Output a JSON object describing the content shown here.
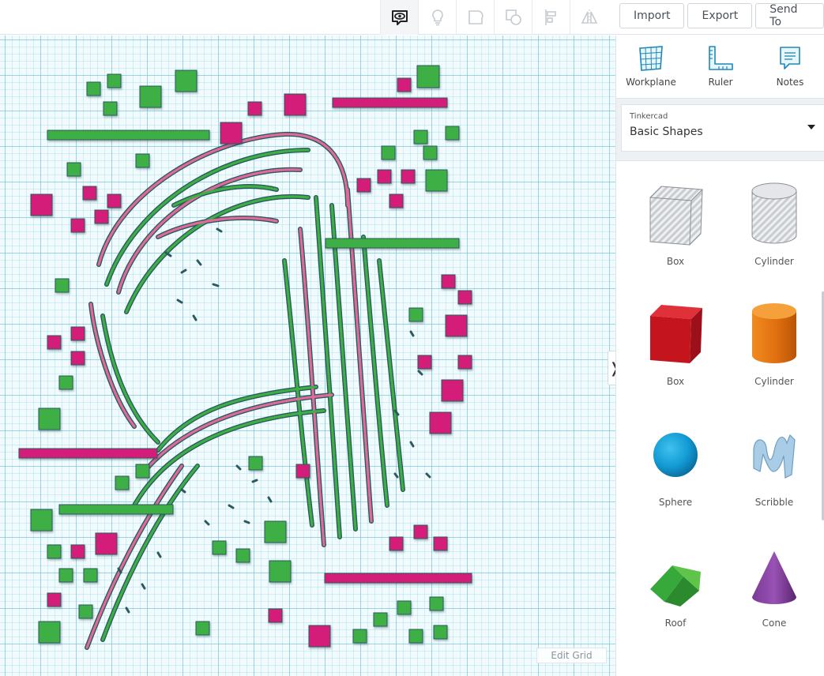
{
  "toolbar": {
    "tools": [
      {
        "name": "show-all-icon",
        "active": true
      },
      {
        "name": "lightbulb-icon",
        "active": false
      },
      {
        "name": "group-icon",
        "active": false
      },
      {
        "name": "ungroup-icon",
        "active": false
      },
      {
        "name": "align-icon",
        "active": false
      },
      {
        "name": "mirror-icon",
        "active": false
      }
    ],
    "import_label": "Import",
    "export_label": "Export",
    "send_to_label": "Send To"
  },
  "canvas": {
    "edit_grid_label": "Edit Grid",
    "colors": {
      "green": "#3daf45",
      "pink": "#d41e79",
      "outline": "#2b5a5e",
      "curve_pink": "#e06a9a"
    }
  },
  "panel": {
    "workplane_label": "Workplane",
    "ruler_label": "Ruler",
    "notes_label": "Notes",
    "library_source": "Tinkercad",
    "library_name": "Basic Shapes",
    "shapes": [
      {
        "label": "Box",
        "icon": "box-hole-icon"
      },
      {
        "label": "Cylinder",
        "icon": "cylinder-hole-icon"
      },
      {
        "label": "Box",
        "icon": "box-red-icon"
      },
      {
        "label": "Cylinder",
        "icon": "cylinder-orange-icon"
      },
      {
        "label": "Sphere",
        "icon": "sphere-icon"
      },
      {
        "label": "Scribble",
        "icon": "scribble-icon"
      },
      {
        "label": "Roof",
        "icon": "roof-icon"
      },
      {
        "label": "Cone",
        "icon": "cone-icon"
      }
    ]
  }
}
